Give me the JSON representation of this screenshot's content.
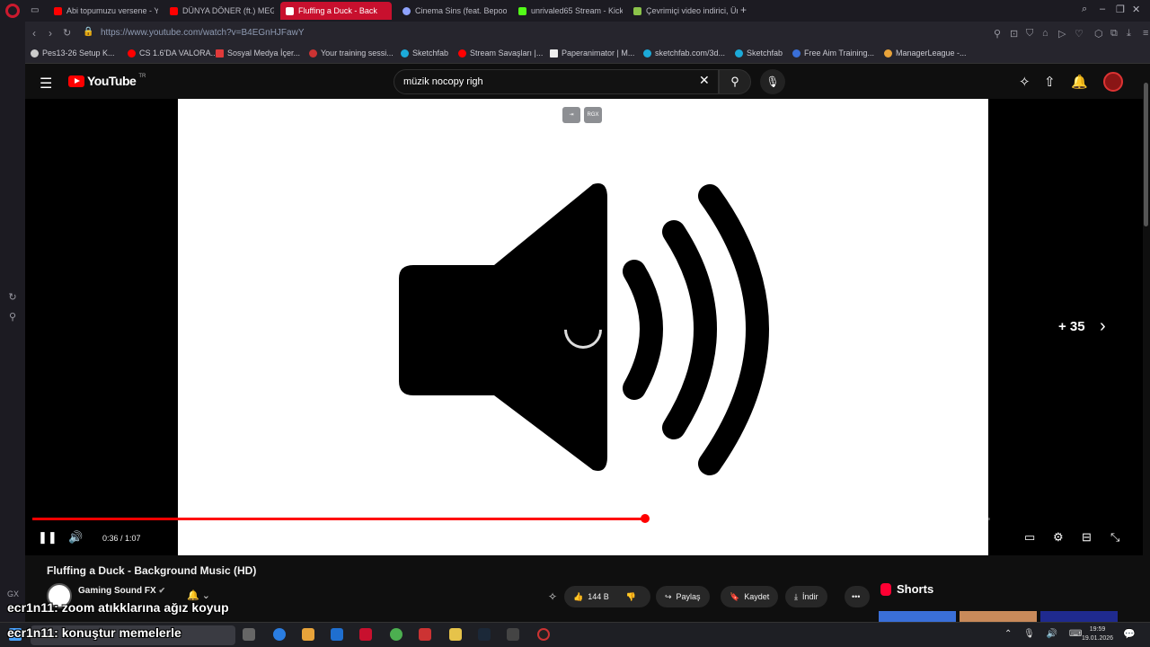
{
  "browser": {
    "tabs": [
      {
        "label": "Abi topumuzu versene - Yo",
        "color": "#ff0000"
      },
      {
        "label": "DÜNYA DÖNER (ft.) MEG",
        "color": "#ff0000"
      },
      {
        "label": "Fluffing a Duck - Back",
        "color": "#ffffff",
        "active": true
      },
      {
        "label": "Cinema Sins (feat. Bepoo)",
        "color": "#8fa3ff"
      },
      {
        "label": "unrivaled65 Stream - Kick",
        "color": "#53fc18"
      },
      {
        "label": "Çevrimiçi video indirici, Ün",
        "color": "#8bc34a"
      }
    ],
    "new_tab": "+",
    "url": "https://www.youtube.com/watch?v=B4EGnHJFawY",
    "bookmarks": [
      "Pes13-26 Setup K...",
      "CS 1.6'DA VALORA...",
      "Sosyal Medya İçer...",
      "Your training sessi...",
      "Sketchfab",
      "Stream Savaşları |...",
      "Paperanimator | M...",
      "sketchfab.com/3d...",
      "Sketchfab",
      "Free Aim Training...",
      "ManagerLeague -..."
    ],
    "sidebar_label": "GX"
  },
  "youtube": {
    "logo_text": "YouTube",
    "logo_region": "TR",
    "search_value": "müzik nocopy righ",
    "player": {
      "time": "0:36 / 1:07",
      "played_fraction": 0.64,
      "buffered_fraction": 0.84,
      "more_count": "+ 35",
      "ext_label": "RGX"
    },
    "video": {
      "title": "Fluffing a Duck - Background Music (HD)",
      "channel": "Gaming Sound FX",
      "likes": "144 B",
      "share_label": "Paylaş",
      "save_label": "Kaydet",
      "download_label": "İndir"
    },
    "shorts_label": "Shorts"
  },
  "overlay_chat": [
    {
      "user": "ecr1n11",
      "message": ": zoom atıkklarına ağız koyup"
    },
    {
      "user": "ecr1n11",
      "message": ": konuştur memelerle"
    }
  ],
  "taskbar": {
    "time": "19:59",
    "date": "19.01.2026"
  },
  "colors": {
    "accent": "#ff0000",
    "active_tab": "#c8102e",
    "background": "#0f0f0f"
  }
}
